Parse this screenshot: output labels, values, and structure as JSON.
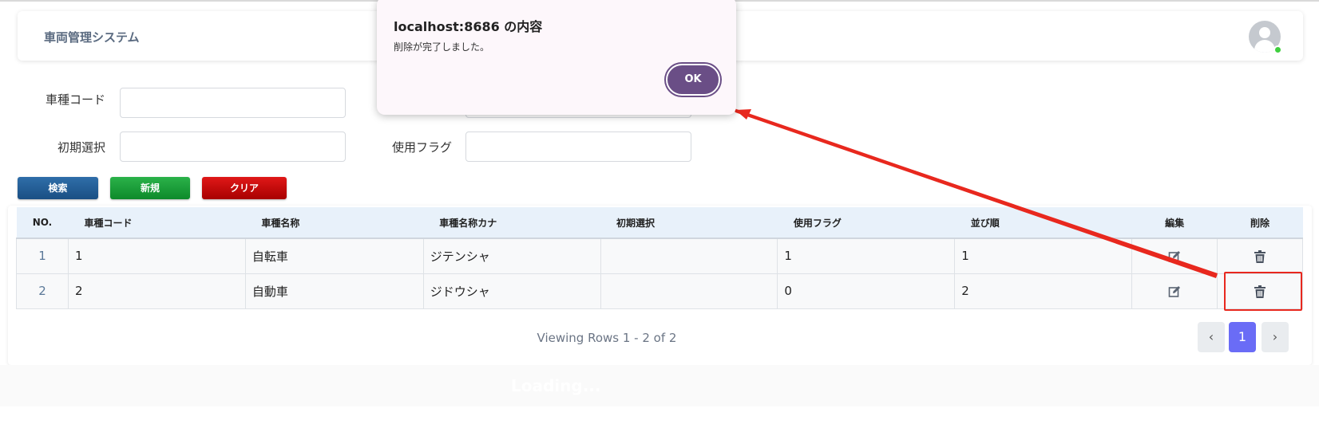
{
  "header": {
    "title": "車両管理システム"
  },
  "search": {
    "code_label": "車種コード",
    "initial_label": "初期選択",
    "flag_label": "使用フラグ",
    "code_value": "",
    "initial_value": "",
    "flag_value": ""
  },
  "buttons": {
    "search": "検索",
    "new": "新規",
    "clear": "クリア"
  },
  "table": {
    "headers": [
      "NO.",
      "車種コード",
      "車種名称",
      "車種名称カナ",
      "初期選択",
      "使用フラグ",
      "並び順",
      "編集",
      "削除"
    ],
    "rows": [
      {
        "no": "1",
        "code": "1",
        "name": "自転車",
        "kana": "ジテンシャ",
        "initial": "",
        "flag": "1",
        "order": "1"
      },
      {
        "no": "2",
        "code": "2",
        "name": "自動車",
        "kana": "ジドウシャ",
        "initial": "",
        "flag": "0",
        "order": "2"
      }
    ]
  },
  "pagination": {
    "summary": "Viewing Rows 1 - 2 of 2",
    "prev": "‹",
    "current": "1",
    "next": "›"
  },
  "loading": "Loading...",
  "dialog": {
    "title": "localhost:8686 の内容",
    "message": "削除が完了しました。",
    "ok": "OK"
  },
  "colors": {
    "accent": "#6a4e86",
    "page_active": "#6a6cf6",
    "annotation": "#e8281e"
  }
}
